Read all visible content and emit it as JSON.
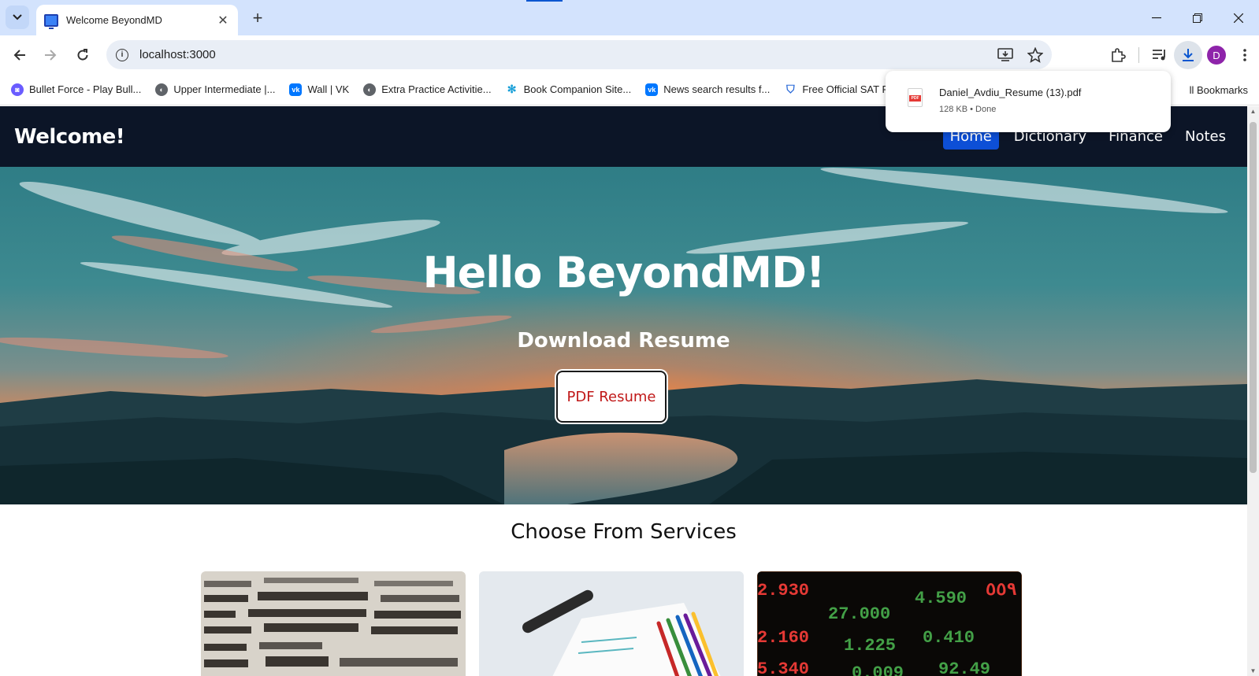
{
  "browser": {
    "tab": {
      "title": "Welcome BeyondMD"
    },
    "url": "localhost:3000",
    "bookmarks": [
      {
        "label": "Bullet Force - Play Bull...",
        "color": "#6a5cff"
      },
      {
        "label": "Upper Intermediate |...",
        "color": "#5f6368"
      },
      {
        "label": "Wall | VK",
        "color": "#0077ff"
      },
      {
        "label": "Extra Practice Activitie...",
        "color": "#5f6368"
      },
      {
        "label": "Book Companion Site...",
        "color": "#1aa0d8"
      },
      {
        "label": "News search results f...",
        "color": "#0077ff"
      },
      {
        "label": "Free Official SAT Pract...",
        "color": "#2a6ad8"
      }
    ],
    "all_bookmarks": "ll Bookmarks",
    "avatar_initial": "D"
  },
  "download": {
    "filename": "Daniel_Avdiu_Resume (13).pdf",
    "status": "128 KB • Done",
    "icon_label": "PDF"
  },
  "navbar": {
    "brand": "Welcome!",
    "links": [
      "Home",
      "Dictionary",
      "Finance",
      "Notes"
    ],
    "active": "Home"
  },
  "hero": {
    "title": "Hello BeyondMD!",
    "subtitle": "Download Resume",
    "button": "PDF Resume"
  },
  "services": {
    "title": "Choose From Services"
  },
  "colors": {
    "navbar_bg": "#0c1527",
    "active_link": "#0d4fd6",
    "pdf_button_text": "#c01818"
  }
}
